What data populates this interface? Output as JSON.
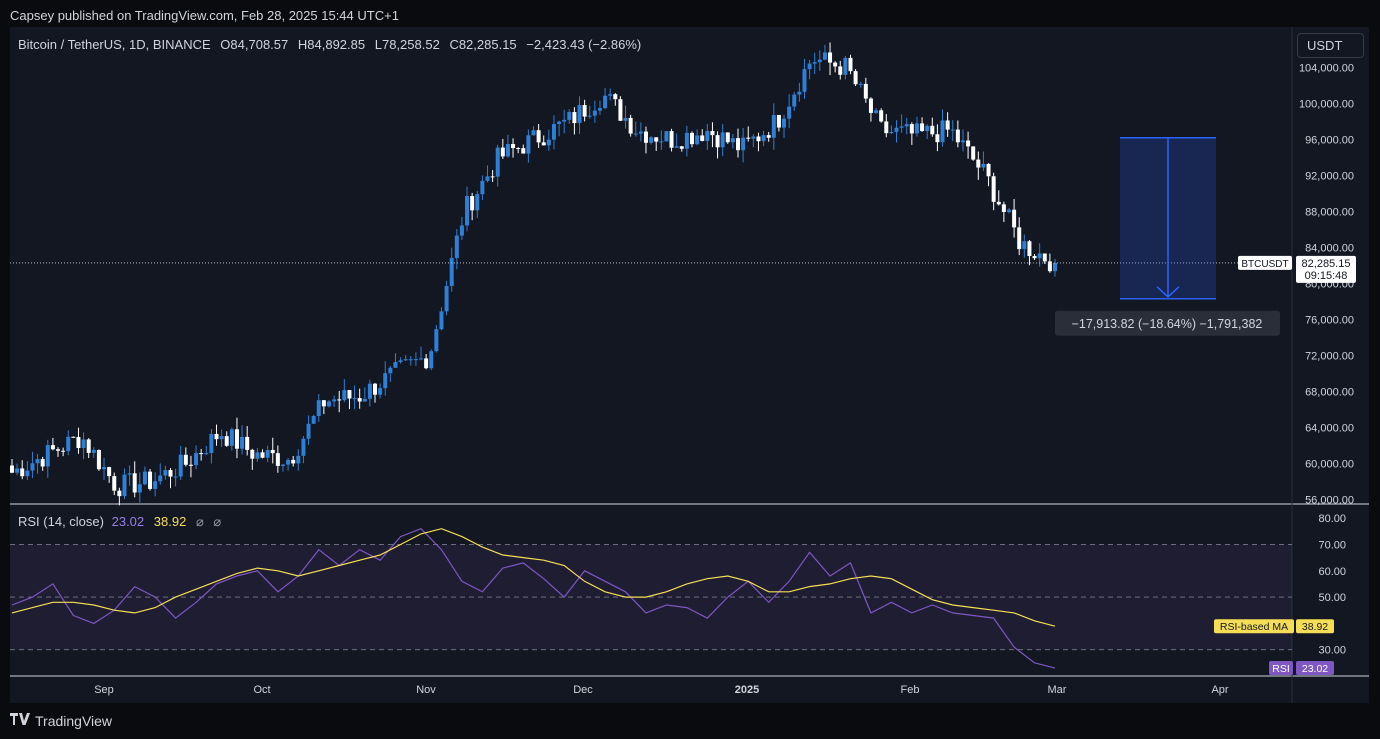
{
  "header": {
    "published": "Capsey published on TradingView.com, Feb 28, 2025 15:44 UTC+1"
  },
  "legend": {
    "symbol": "Bitcoin / TetherUS, 1D, BINANCE",
    "open": "O84,708.57",
    "high": "H84,892.85",
    "low": "L78,258.52",
    "close": "C82,285.15",
    "change": "−2,423.43 (−2.86%)"
  },
  "currency_button": "USDT",
  "price_scale_labels": [
    "104,000.00",
    "100,000.00",
    "96,000.00",
    "92,000.00",
    "88,000.00",
    "84,000.00",
    "80,000.00",
    "76,000.00",
    "72,000.00",
    "68,000.00",
    "64,000.00",
    "60,000.00",
    "56,000.00"
  ],
  "last_price": {
    "symbol_tag": "BTCUSDT",
    "price": "82,285.15",
    "countdown": "09:15:48"
  },
  "measure": {
    "label": "−17,913.82 (−18.64%) −1,791,382",
    "from": 96200,
    "to": 78300
  },
  "rsi": {
    "title": "RSI (14, close)",
    "value": "23.02",
    "ma_value": "38.92",
    "eye1": "⌀",
    "eye2": "⌀",
    "scale_labels": [
      "80.00",
      "70.00",
      "60.00",
      "50.00",
      "30.00"
    ],
    "ma_tag": "RSI-based MA",
    "ma_tag_value": "38.92",
    "rsi_tag": "RSI",
    "rsi_tag_value": "23.02"
  },
  "time_labels": [
    "Sep",
    "Oct",
    "Nov",
    "Dec",
    "2025",
    "Feb",
    "Mar",
    "Apr"
  ],
  "footer": {
    "brand": "TradingView"
  },
  "colors": {
    "up": "#2e7fd6",
    "down": "#ffffff",
    "rsi": "#7e57c2",
    "rsi_ma": "#f5de55",
    "measure": "#2962ff"
  },
  "chart_data": {
    "type": "candlestick",
    "title": "Bitcoin / TetherUS, 1D, BINANCE",
    "ylim": [
      55500,
      108500
    ],
    "price_series": {
      "name": "BTCUSDT close (approx.)",
      "x": [
        "2024-08-14",
        "2024-08-21",
        "2024-08-28",
        "2024-09-04",
        "2024-09-11",
        "2024-09-18",
        "2024-09-25",
        "2024-10-02",
        "2024-10-09",
        "2024-10-16",
        "2024-10-23",
        "2024-10-30",
        "2024-11-06",
        "2024-11-13",
        "2024-11-20",
        "2024-11-27",
        "2024-12-04",
        "2024-12-11",
        "2024-12-18",
        "2024-12-25",
        "2025-01-01",
        "2025-01-08",
        "2025-01-15",
        "2025-01-22",
        "2025-01-29",
        "2025-02-05",
        "2025-02-12",
        "2025-02-19",
        "2025-02-24",
        "2025-02-26",
        "2025-02-28"
      ],
      "values": [
        59000,
        61000,
        63000,
        57500,
        58000,
        60000,
        63500,
        61000,
        60500,
        67000,
        67500,
        70000,
        72000,
        88000,
        94000,
        96000,
        98000,
        101000,
        97000,
        96000,
        97000,
        95000,
        98000,
        105000,
        104000,
        97000,
        96500,
        97000,
        92000,
        84500,
        82285
      ]
    },
    "rsi_series": {
      "name": "RSI (14, close)",
      "ylim": [
        20,
        85
      ],
      "levels": [
        70,
        50,
        30
      ],
      "values": [
        47,
        50,
        55,
        43,
        40,
        45,
        54,
        50,
        42,
        48,
        55,
        58,
        60,
        52,
        58,
        68,
        62,
        68,
        64,
        73,
        76,
        68,
        56,
        52,
        61,
        63,
        57,
        50,
        60,
        56,
        52,
        44,
        47,
        46,
        42,
        50,
        56,
        48,
        56,
        67,
        58,
        63,
        44,
        48,
        44,
        47,
        44,
        43,
        42,
        31,
        25,
        23.02
      ]
    },
    "rsi_ma_series": {
      "name": "RSI-based MA",
      "values": [
        44,
        46,
        48,
        48,
        47,
        45,
        44,
        46,
        50,
        53,
        56,
        59,
        61,
        60,
        58,
        60,
        62,
        64,
        66,
        70,
        74,
        76,
        73,
        69,
        66,
        65,
        64,
        62,
        56,
        52,
        50,
        50,
        52,
        55,
        57,
        58,
        56,
        52,
        52,
        54,
        55,
        57,
        58,
        57,
        53,
        49,
        47,
        46,
        45,
        44,
        41,
        38.92
      ]
    },
    "xlabel": "",
    "ylabel": "",
    "xticks": [
      "Sep",
      "Oct",
      "Nov",
      "Dec",
      "2025",
      "Feb",
      "Mar",
      "Apr"
    ]
  }
}
